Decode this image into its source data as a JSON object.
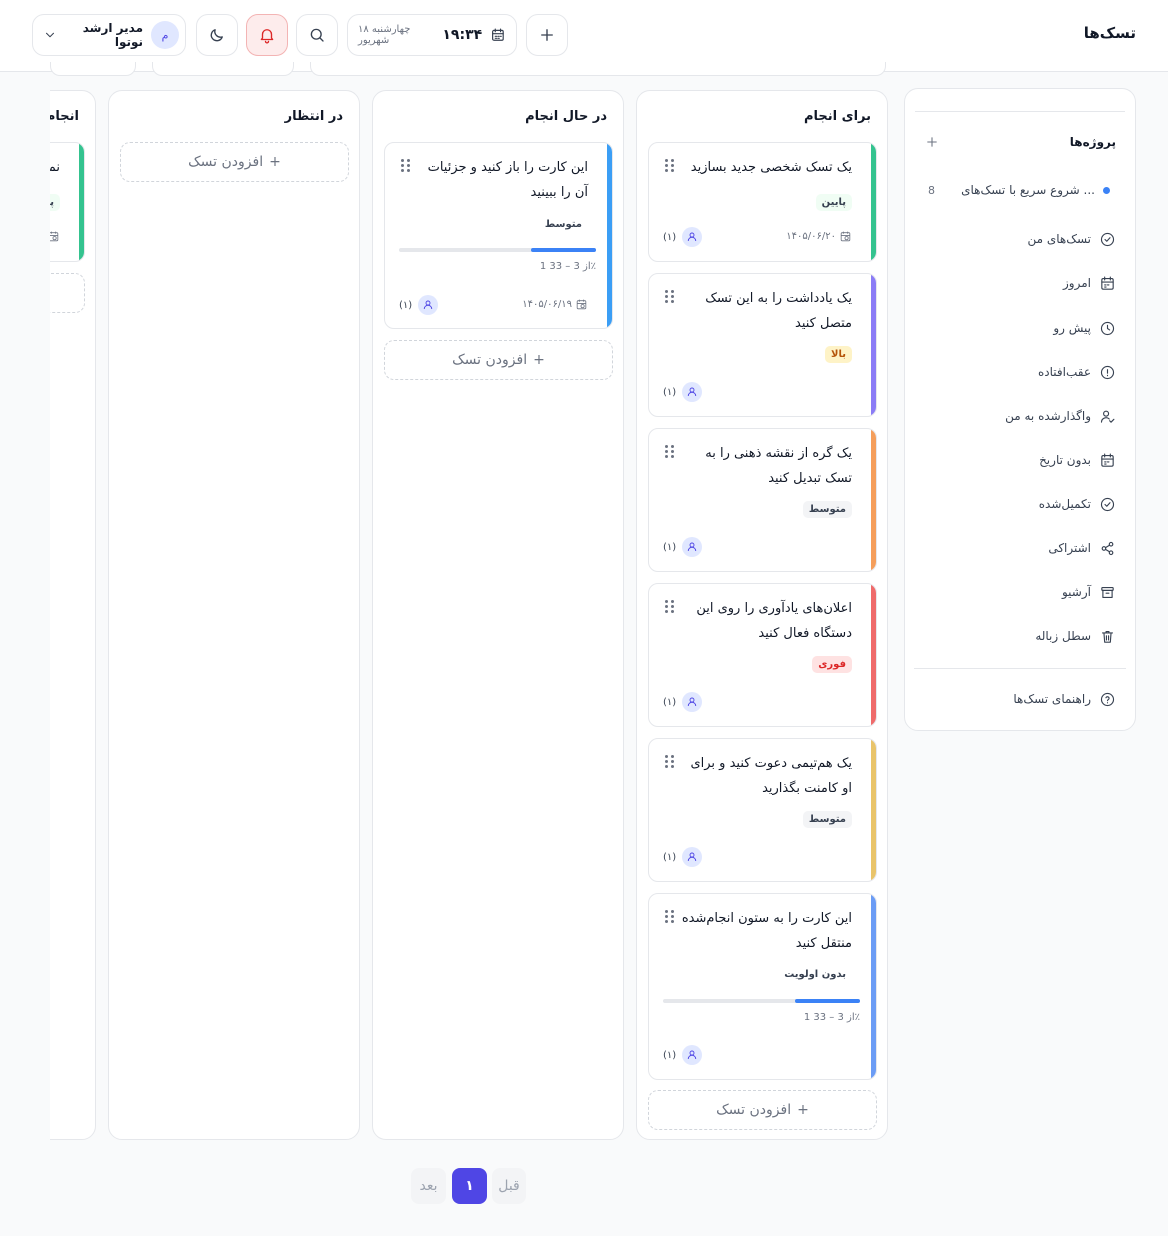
{
  "header": {
    "title": "تسک‌ها",
    "time": "۱۹:۳۴",
    "date": "چهارشنبه ۱۸ شهریور",
    "user_name": "مدیر ارشد نوتوا",
    "user_initial": "م"
  },
  "sidebar": {
    "projects_title": "پروژه‌ها",
    "project": {
      "name": "شروع سریع با تسک‌های ...",
      "count": "8"
    },
    "items": [
      {
        "label": "تسک‌های من",
        "icon": "check-circle-icon"
      },
      {
        "label": "امروز",
        "icon": "calendar-icon"
      },
      {
        "label": "پیش رو",
        "icon": "clock-icon"
      },
      {
        "label": "عقب‌افتاده",
        "icon": "alert-circle-icon"
      },
      {
        "label": "واگذارشده به من",
        "icon": "user-check-icon"
      },
      {
        "label": "بدون تاریخ",
        "icon": "calendar-icon"
      },
      {
        "label": "تکمیل‌شده",
        "icon": "check-circle-icon"
      },
      {
        "label": "اشتراکی",
        "icon": "share-icon"
      },
      {
        "label": "آرشیو",
        "icon": "archive-icon"
      },
      {
        "label": "سطل زباله",
        "icon": "trash-icon"
      }
    ],
    "help_label": "راهنمای تسک‌ها"
  },
  "columns": {
    "todo": {
      "title": "برای انجام",
      "cards": [
        {
          "title": "یک تسک شخصی جدید بسازید",
          "priority": "پایین",
          "due": "۱۴۰۵/۰۶/۲۰",
          "assignees": "(۱)",
          "color": "#34c38f"
        },
        {
          "title": "یک یادداشت را به این تسک متصل کنید",
          "priority": "بالا",
          "assignees": "(۱)",
          "color": "#8b7cf6"
        },
        {
          "title": "یک گره از نقشه ذهنی را به تسک تبدیل کنید",
          "priority": "متوسط",
          "assignees": "(۱)",
          "color": "#f59e5b"
        },
        {
          "title": "اعلان‌های یادآوری را روی این دستگاه فعال کنید",
          "priority": "فوری",
          "assignees": "(۱)",
          "color": "#ef6b6b"
        },
        {
          "title": "یک هم‌تیمی دعوت کنید و برای او کامنت بگذارید",
          "priority": "متوسط",
          "assignees": "(۱)",
          "color": "#e9c46a"
        },
        {
          "title": "این کارت را به ستون انجام‌شده منتقل کنید",
          "priority": "بدون اولویت",
          "progress": 0.33,
          "progress_label": "1 از 3 – 33٪",
          "assignees": "(۱)",
          "color": "#6b9cf5"
        }
      ],
      "add_label": "افزودن تسک"
    },
    "doing": {
      "title": "در حال انجام",
      "cards": [
        {
          "title": "این کارت را باز کنید و جزئیات آن را ببینید",
          "priority": "متوسط",
          "progress": 0.33,
          "progress_label": "1 از 3 – 33٪",
          "due": "۱۴۰۵/۰۶/۱۹",
          "assignees": "(۱)",
          "color": "#3b9ef5"
        }
      ],
      "add_label": "افزودن تسک"
    },
    "waiting": {
      "title": "در انتظار",
      "add_label": "افزودن تسک"
    },
    "done": {
      "title": "انجام",
      "card_title": "نمو",
      "card_priority": "پایی",
      "color": "#34c38f"
    }
  },
  "pagination": {
    "prev": "قبل",
    "current": "۱",
    "next": "بعد"
  }
}
